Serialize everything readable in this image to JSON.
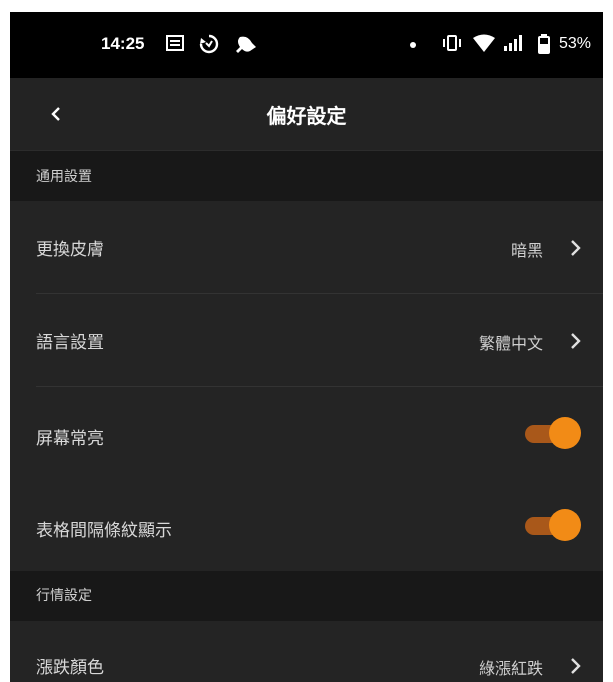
{
  "status_bar": {
    "time": "14:25",
    "battery": "53%",
    "icons": [
      "news-icon",
      "sync-icon",
      "notification-bell-icon",
      "dot-icon",
      "vibrate-icon",
      "wifi-icon",
      "signal-icon",
      "battery-icon"
    ]
  },
  "header": {
    "title": "偏好設定",
    "back_icon": "chevron-left-icon"
  },
  "sections": [
    {
      "title": "通用設置",
      "rows": [
        {
          "label": "更換皮膚",
          "value": "暗黑",
          "type": "link"
        },
        {
          "label": "語言設置",
          "value": "繁體中文",
          "type": "link"
        },
        {
          "label": "屏幕常亮",
          "type": "toggle",
          "enabled": true
        },
        {
          "label": "表格間隔條紋顯示",
          "type": "toggle",
          "enabled": true
        }
      ]
    },
    {
      "title": "行情設定",
      "rows": [
        {
          "label": "漲跌顏色",
          "value": "綠漲紅跌",
          "type": "link"
        }
      ]
    }
  ],
  "colors": {
    "accent": "#f28b16",
    "toggle_track": "#a9581a",
    "background": "#1e1e1e",
    "row_background": "#242424",
    "section_background": "#181818"
  }
}
